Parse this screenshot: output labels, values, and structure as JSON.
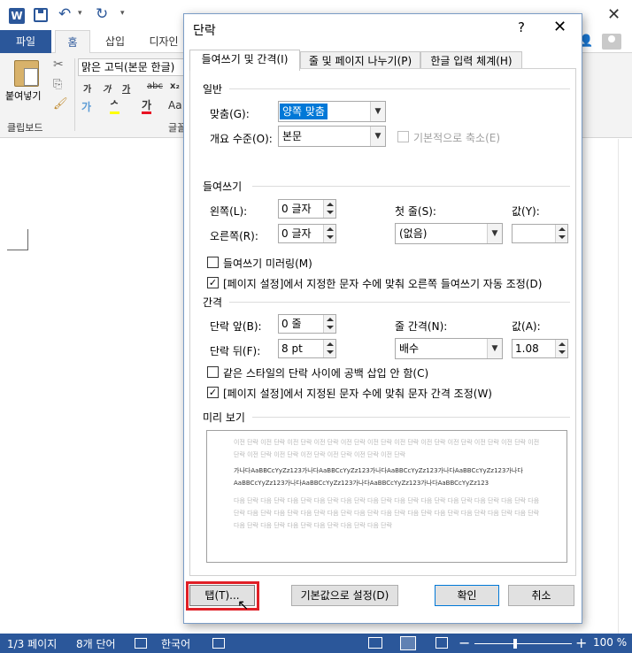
{
  "app": {
    "logo": "W",
    "quick_access": {
      "undo": "↶",
      "undo_arrow": "▾",
      "redo": "↻",
      "custom": "▾"
    },
    "window_close": "✕"
  },
  "ribbon": {
    "tabs": {
      "file": "파일",
      "home": "홈",
      "insert": "삽입",
      "design": "디자인"
    },
    "clipboard": {
      "paste_label": "붙여넣기",
      "group_label": "클립보드"
    },
    "font": {
      "name": "맑은 고딕(본문 한글)",
      "group_label": "글꼴",
      "buttons": [
        "가",
        "가",
        "가",
        "abc",
        "x₂",
        "Aa"
      ],
      "effects": "가",
      "highlight": "ᄼ",
      "font_color": "가"
    },
    "icons": {
      "cut": "✂",
      "copy": "⎘",
      "painter": "🖌",
      "share": "👤"
    }
  },
  "dialog": {
    "title": "단락",
    "help": "?",
    "close": "✕",
    "tabs": {
      "indent": "들여쓰기 및 간격(I)",
      "breaks": "줄 및 페이지 나누기(P)",
      "asian": "한글 입력 체계(H)"
    },
    "general": {
      "section": "일반",
      "alignment_label": "맞춤(G):",
      "alignment_value": "양쪽 맞춤",
      "outline_label": "개요 수준(O):",
      "outline_value": "본문",
      "collapsed_label": "기본적으로 축소(E)"
    },
    "indentation": {
      "section": "들여쓰기",
      "left_label": "왼쪽(L):",
      "left_value": "0 글자",
      "right_label": "오른쪽(R):",
      "right_value": "0 글자",
      "special_label": "첫 줄(S):",
      "special_value": "(없음)",
      "by_label": "값(Y):",
      "by_value": "",
      "mirror_label": "들여쓰기 미러링(M)",
      "mirror_checked": false,
      "auto_adjust_label": "[페이지 설정]에서 지정한 문자 수에 맞춰 오른쪽 들여쓰기 자동 조정(D)",
      "auto_adjust_checked": true
    },
    "spacing": {
      "section": "간격",
      "before_label": "단락 앞(B):",
      "before_value": "0 줄",
      "after_label": "단락 뒤(F):",
      "after_value": "8 pt",
      "line_label": "줄 간격(N):",
      "line_value": "배수",
      "at_label": "값(A):",
      "at_value": "1.08",
      "no_space_label": "같은 스타일의 단락 사이에 공백 삽입 안 함(C)",
      "no_space_checked": false,
      "snap_grid_label": "[페이지 설정]에서 지정된 문자 수에 맞춰 문자 간격 조정(W)",
      "snap_grid_checked": true
    },
    "preview": {
      "section": "미리 보기",
      "prev_text": "이전 단락 이전 단락 이전 단락 이전 단락 이전 단락 이전 단락 이전 단락 이전 단락 이전 단락 이전 단락 이전 단락 이전 단락 이전 단락 이전 단락 이전 단락 이전 단락 이전 단락 이전 단락",
      "current_text": "가나다AaBBCcYyZz123가나다AaBBCcYyZz123가나다AaBBCcYyZz123가나다AaBBCcYyZz123가나다 AaBBCcYyZz123가나다AaBBCcYyZz123가나다AaBBCcYyZz123가나다AaBBCcYyZz123",
      "next_text": "다음 단락 다음 단락 다음 단락 다음 단락 다음 단락 다음 단락 다음 단락 다음 단락 다음 단락 다음 단락 다음 단락 다음 단락 다음 단락 다음 단락 다음 단락 다음 단락 다음 단락 다음 단락 다음 단락 다음 단락 다음 단락 다음 단락 다음 단락 다음 단락 다음 단락 다음 단락 다음 단락 다음 단락 다음 단락"
    },
    "buttons": {
      "tabs": "탭(T)...",
      "set_default": "기본값으로 설정(D)",
      "ok": "확인",
      "cancel": "취소"
    }
  },
  "statusbar": {
    "page": "1/3 페이지",
    "words": "8개 단어",
    "language": "한국어",
    "zoom_minus": "−",
    "zoom_plus": "+",
    "zoom": "100 %"
  },
  "colors": {
    "accent": "#2b579a",
    "highlight_frame": "#e01f26",
    "selection": "#0078d7"
  }
}
